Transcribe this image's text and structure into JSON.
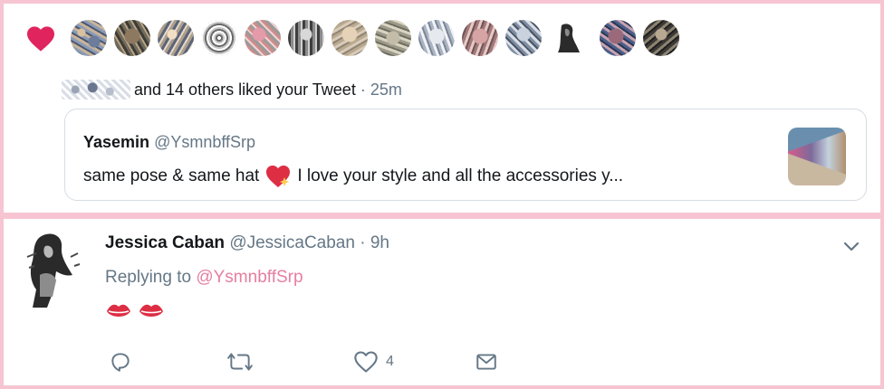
{
  "notification": {
    "liked_suffix": "and 14 others liked your Tweet",
    "time": "· 25m",
    "icon": "heart-icon",
    "accent": "#e0245e"
  },
  "quoted_tweet": {
    "name": "Yasemin",
    "handle": "@YsmnbffSrp",
    "text_before": "same pose & same hat",
    "text_after": "I love your style and all the accessories y..."
  },
  "reply": {
    "name": "Jessica Caban",
    "handle": "@JessicaCaban",
    "time": "· 9h",
    "replying_prefix": "Replying to",
    "replying_handle": "@YsmnbffSrp",
    "like_count": "4"
  },
  "colors": {
    "border": "#f7c5d2",
    "mention": "#e57fa0",
    "muted": "#657786"
  }
}
